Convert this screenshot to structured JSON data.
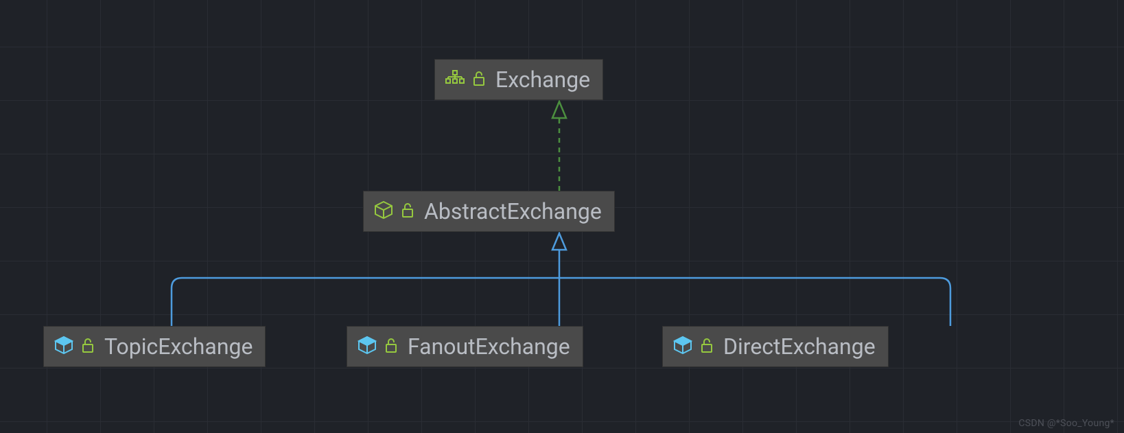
{
  "diagram": {
    "nodes": {
      "exchange": {
        "label": "Exchange",
        "type": "interface"
      },
      "abstract_exchange": {
        "label": "AbstractExchange",
        "type": "abstract_class"
      },
      "topic_exchange": {
        "label": "TopicExchange",
        "type": "class"
      },
      "fanout_exchange": {
        "label": "FanoutExchange",
        "type": "class"
      },
      "direct_exchange": {
        "label": "DirectExchange",
        "type": "class"
      }
    },
    "relationships": [
      {
        "from": "abstract_exchange",
        "to": "exchange",
        "kind": "implements"
      },
      {
        "from": "topic_exchange",
        "to": "abstract_exchange",
        "kind": "extends"
      },
      {
        "from": "fanout_exchange",
        "to": "abstract_exchange",
        "kind": "extends"
      },
      {
        "from": "direct_exchange",
        "to": "abstract_exchange",
        "kind": "extends"
      }
    ],
    "colors": {
      "interface_icon": "#96c93f",
      "abstract_icon": "#96c93f",
      "class_icon": "#5dc6f0",
      "lock_icon": "#96c93f",
      "implements_arrow": "#4c8f3f",
      "extends_arrow": "#4e9cde"
    }
  },
  "watermark": "CSDN @*Soo_Young*"
}
